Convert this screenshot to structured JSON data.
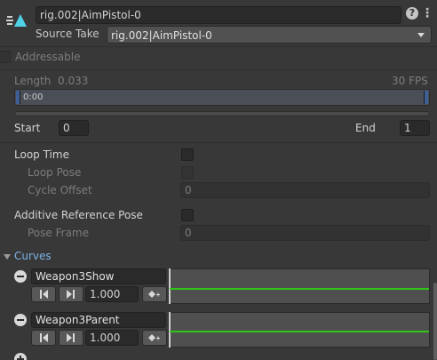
{
  "header": {
    "name_value": "rig.002|AimPistol-0",
    "source_take_label": "Source Take",
    "source_take_value": "rig.002|AimPistol-0",
    "help_glyph": "?",
    "menu_glyph": "⋮"
  },
  "addressable": {
    "label": "Addressable"
  },
  "timeline": {
    "length_label": "Length",
    "length_value": "0.033",
    "fps": "30 FPS",
    "time_marker": "0:00"
  },
  "range": {
    "start_label": "Start",
    "start_value": "0",
    "end_label": "End",
    "end_value": "1"
  },
  "loop": {
    "loop_time_label": "Loop Time",
    "loop_pose_label": "Loop Pose",
    "cycle_offset_label": "Cycle Offset",
    "cycle_offset_value": "0"
  },
  "additive": {
    "label": "Additive Reference Pose",
    "pose_frame_label": "Pose Frame",
    "pose_frame_value": "0"
  },
  "curves": {
    "header": "Curves",
    "items": [
      {
        "name": "Weapon3Show",
        "value": "1.000"
      },
      {
        "name": "Weapon3Parent",
        "value": "1.000"
      }
    ]
  },
  "colors": {
    "background": "#383838",
    "field": "#2a2a2a",
    "accent_blue": "#7fb3e8",
    "curve_green": "#31c419",
    "asset_icon": "#4fd1e8"
  },
  "icons": [
    "animation-clip-icon",
    "help-icon",
    "menu-icon",
    "dropdown-arrow-icon",
    "remove-curve-icon",
    "previous-key-icon",
    "next-key-icon",
    "add-key-icon",
    "add-curve-icon",
    "foldout-arrow-icon"
  ]
}
